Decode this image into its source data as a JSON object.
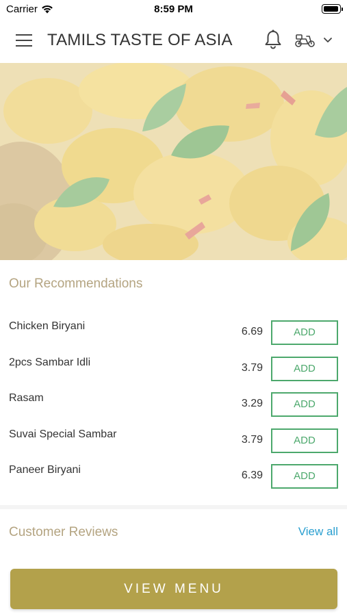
{
  "status_bar": {
    "carrier": "Carrier",
    "time": "8:59 PM"
  },
  "header": {
    "title": "TAMILS TASTE OF ASIA"
  },
  "recommendations": {
    "title": "Our Recommendations",
    "items": [
      {
        "name": "Chicken Biryani",
        "price": "6.69",
        "button": "ADD"
      },
      {
        "name": "2pcs Sambar Idli",
        "price": "3.79",
        "button": "ADD"
      },
      {
        "name": "Rasam",
        "price": "3.29",
        "button": "ADD"
      },
      {
        "name": "Suvai Special Sambar",
        "price": "3.79",
        "button": "ADD"
      },
      {
        "name": "Paneer Biryani",
        "price": "6.39",
        "button": "ADD"
      }
    ]
  },
  "reviews": {
    "title": "Customer Reviews",
    "view_all": "View all"
  },
  "footer": {
    "view_menu": "VIEW MENU"
  },
  "colors": {
    "accent_gold": "#b3a14b",
    "section_title": "#b4a481",
    "add_green": "#4ca86c",
    "link_blue": "#2a9fd0"
  },
  "icons": [
    "wifi-icon",
    "battery-icon",
    "menu-icon",
    "bell-icon",
    "scooter-icon",
    "chevron-down-icon"
  ]
}
